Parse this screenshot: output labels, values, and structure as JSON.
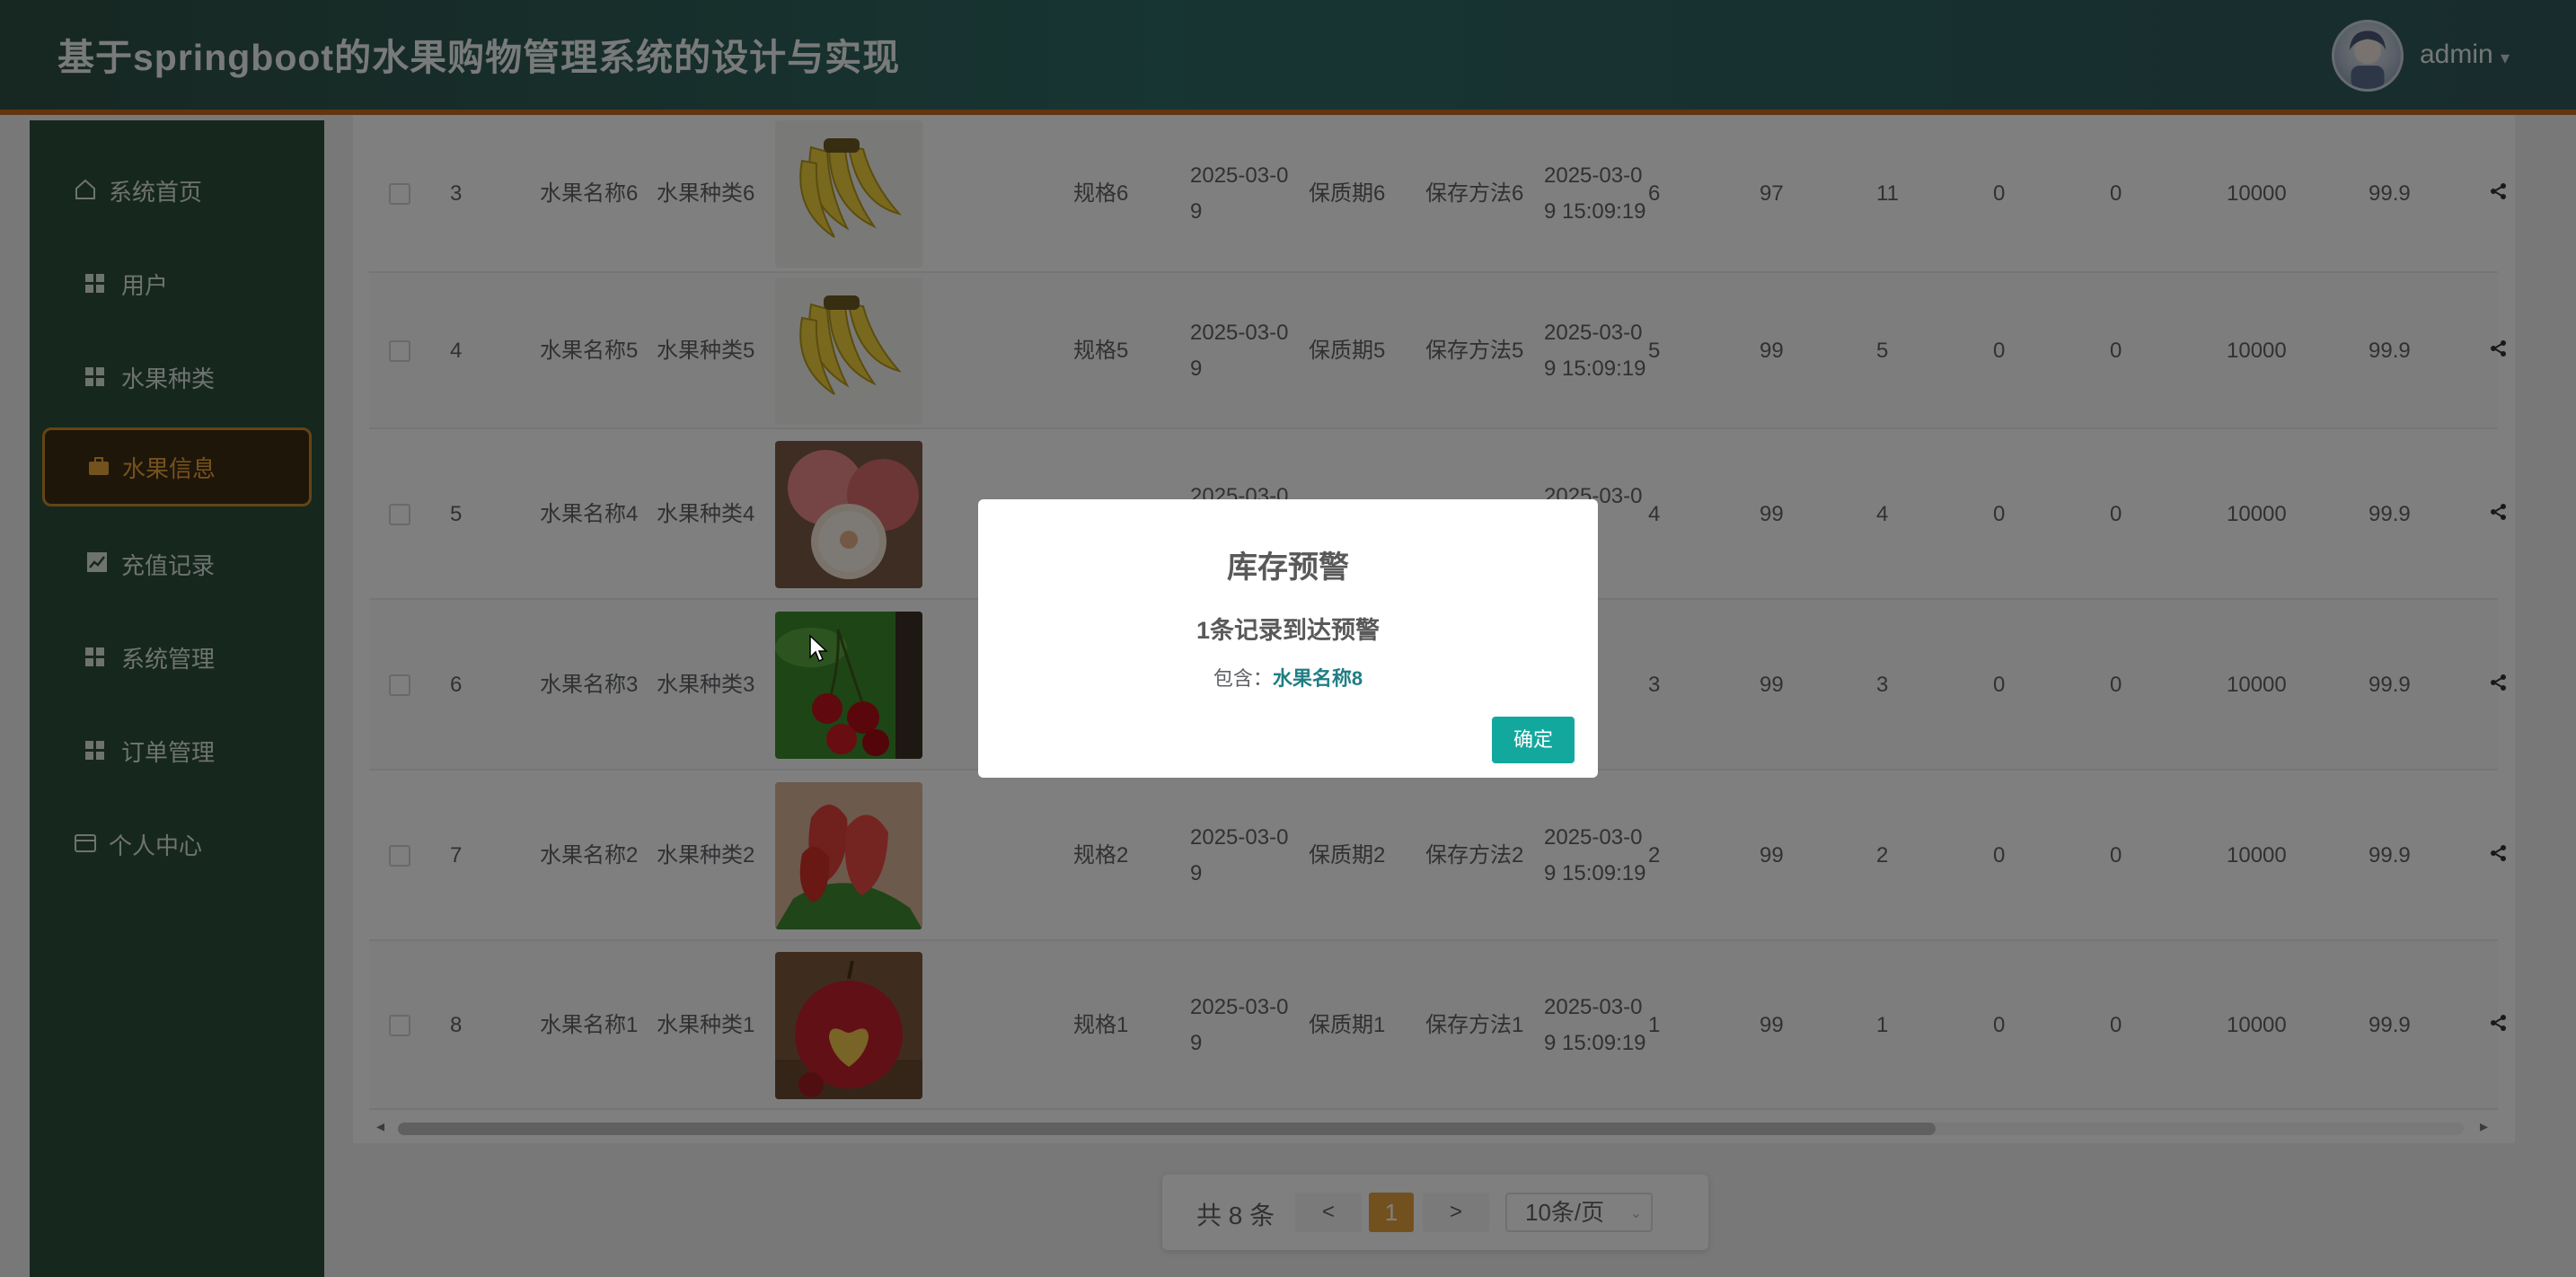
{
  "header": {
    "title": "基于springboot的水果购物管理系统的设计与实现",
    "user": "admin"
  },
  "sidebar": {
    "items": [
      {
        "label": "系统首页",
        "icon": "home-icon"
      },
      {
        "label": "用户",
        "icon": "grid-icon"
      },
      {
        "label": "水果种类",
        "icon": "grid-icon"
      },
      {
        "label": "水果信息",
        "icon": "briefcase-icon",
        "active": true
      },
      {
        "label": "充值记录",
        "icon": "chart-icon"
      },
      {
        "label": "系统管理",
        "icon": "grid-icon"
      },
      {
        "label": "订单管理",
        "icon": "grid-icon"
      },
      {
        "label": "个人中心",
        "icon": "card-icon"
      }
    ]
  },
  "table": {
    "rows": [
      {
        "idx": "3",
        "name": "水果名称6",
        "kind": "水果种类6",
        "image": "banana",
        "spec": "规格6",
        "date1a": "2025-03-0",
        "date1b": "9",
        "shelf": "保质期6",
        "store": "保存方法6",
        "date2a": "2025-03-0",
        "date2b": "9 15:09:19",
        "c1": "6",
        "c2": "97",
        "c3": "11",
        "c4": "0",
        "c5": "0",
        "c6": "10000",
        "c7": "99.9"
      },
      {
        "idx": "4",
        "name": "水果名称5",
        "kind": "水果种类5",
        "image": "banana",
        "spec": "规格5",
        "date1a": "2025-03-0",
        "date1b": "9",
        "shelf": "保质期5",
        "store": "保存方法5",
        "date2a": "2025-03-0",
        "date2b": "9 15:09:19",
        "c1": "5",
        "c2": "99",
        "c3": "5",
        "c4": "0",
        "c5": "0",
        "c6": "10000",
        "c7": "99.9"
      },
      {
        "idx": "5",
        "name": "水果名称4",
        "kind": "水果种类4",
        "image": "peach",
        "spec": "",
        "date1a": "2025-03-0",
        "date1b": "",
        "shelf": "",
        "store": "",
        "date2a": "2025-03-0",
        "date2b": ":19",
        "c1": "4",
        "c2": "99",
        "c3": "4",
        "c4": "0",
        "c5": "0",
        "c6": "10000",
        "c7": "99.9"
      },
      {
        "idx": "6",
        "name": "水果名称3",
        "kind": "水果种类3",
        "image": "cherry",
        "spec": "",
        "date1a": "",
        "date1b": "",
        "shelf": "",
        "store": "",
        "date2a": "-03-0",
        "date2b": ":19",
        "c1": "3",
        "c2": "99",
        "c3": "3",
        "c4": "0",
        "c5": "0",
        "c6": "10000",
        "c7": "99.9"
      },
      {
        "idx": "7",
        "name": "水果名称2",
        "kind": "水果种类2",
        "image": "wax-apple",
        "spec": "规格2",
        "date1a": "2025-03-0",
        "date1b": "9",
        "shelf": "保质期2",
        "store": "保存方法2",
        "date2a": "2025-03-0",
        "date2b": "9 15:09:19",
        "c1": "2",
        "c2": "99",
        "c3": "2",
        "c4": "0",
        "c5": "0",
        "c6": "10000",
        "c7": "99.9"
      },
      {
        "idx": "8",
        "name": "水果名称1",
        "kind": "水果种类1",
        "image": "apple",
        "spec": "规格1",
        "date1a": "2025-03-0",
        "date1b": "9",
        "shelf": "保质期1",
        "store": "保存方法1",
        "date2a": "2025-03-0",
        "date2b": "9 15:09:19",
        "c1": "1",
        "c2": "99",
        "c3": "1",
        "c4": "0",
        "c5": "0",
        "c6": "10000",
        "c7": "99.9"
      }
    ]
  },
  "pagination": {
    "total": "共 8 条",
    "prev": "<",
    "page": "1",
    "next": ">",
    "size": "10条/页"
  },
  "dialog": {
    "title": "库存预警",
    "message": "1条记录到达预警",
    "include_label": "包含：",
    "include_item": "水果名称8",
    "ok": "确定"
  },
  "colors": {
    "accent": "#13a89e",
    "active_menu": "#e8a53d",
    "header_border": "#c46a20",
    "page_active": "#e6a23c"
  }
}
